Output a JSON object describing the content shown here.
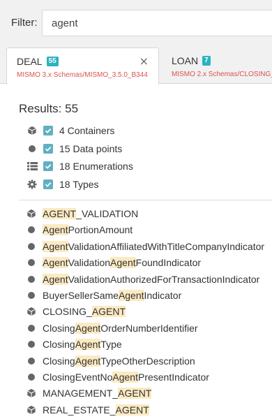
{
  "filter": {
    "label": "Filter:",
    "value": "agent"
  },
  "tabs": [
    {
      "title": "DEAL",
      "count": "55",
      "subtitle": "MISMO 3.x Schemas/MISMO_3.5.0_B344",
      "close": "×"
    },
    {
      "title": "LOAN",
      "count": "7",
      "subtitle": "MISMO 2.x Schemas/CLOSING_"
    }
  ],
  "results_label": "Results: 55",
  "summary": [
    {
      "icon": "cube-icon",
      "label": "4 Containers",
      "checked": true
    },
    {
      "icon": "dot-icon",
      "label": "15 Data points",
      "checked": true
    },
    {
      "icon": "list-icon",
      "label": "18 Enumerations",
      "checked": true
    },
    {
      "icon": "gear-icon",
      "label": "18 Types",
      "checked": true
    }
  ],
  "results": [
    {
      "icon": "cube-icon",
      "parts": [
        [
          "AGENT",
          true
        ],
        [
          "_VALIDATION",
          false
        ]
      ]
    },
    {
      "icon": "dot-icon",
      "parts": [
        [
          "Agent",
          true
        ],
        [
          "PortionAmount",
          false
        ]
      ]
    },
    {
      "icon": "dot-icon",
      "parts": [
        [
          "Agent",
          true
        ],
        [
          "ValidationAffiliatedWithTitleCompanyIndicator",
          false
        ]
      ]
    },
    {
      "icon": "dot-icon",
      "parts": [
        [
          "Agent",
          true
        ],
        [
          "Validation",
          false
        ],
        [
          "Agent",
          true
        ],
        [
          "FoundIndicator",
          false
        ]
      ]
    },
    {
      "icon": "dot-icon",
      "parts": [
        [
          "Agent",
          true
        ],
        [
          "ValidationAuthorizedForTransactionIndicator",
          false
        ]
      ]
    },
    {
      "icon": "dot-icon",
      "parts": [
        [
          "BuyerSellerSame",
          false
        ],
        [
          "Agent",
          true
        ],
        [
          "Indicator",
          false
        ]
      ]
    },
    {
      "icon": "cube-icon",
      "parts": [
        [
          "CLOSING_",
          false
        ],
        [
          "AGENT",
          true
        ]
      ]
    },
    {
      "icon": "dot-icon",
      "parts": [
        [
          "Closing",
          false
        ],
        [
          "Agent",
          true
        ],
        [
          "OrderNumberIdentifier",
          false
        ]
      ]
    },
    {
      "icon": "dot-icon",
      "parts": [
        [
          "Closing",
          false
        ],
        [
          "Agent",
          true
        ],
        [
          "Type",
          false
        ]
      ]
    },
    {
      "icon": "dot-icon",
      "parts": [
        [
          "Closing",
          false
        ],
        [
          "Agent",
          true
        ],
        [
          "TypeOtherDescription",
          false
        ]
      ]
    },
    {
      "icon": "dot-icon",
      "parts": [
        [
          "ClosingEventNo",
          false
        ],
        [
          "Agent",
          true
        ],
        [
          "PresentIndicator",
          false
        ]
      ]
    },
    {
      "icon": "cube-icon",
      "parts": [
        [
          "MANAGEMENT_",
          false
        ],
        [
          "AGENT",
          true
        ]
      ]
    },
    {
      "icon": "cube-icon",
      "parts": [
        [
          "REAL_ESTATE_",
          false
        ],
        [
          "AGENT",
          true
        ]
      ]
    }
  ],
  "colors": {
    "badge": "#2bb3c0",
    "checkbox": "#5fb0c3",
    "highlight": "#fbeac2",
    "subtitle": "#d9534f"
  }
}
